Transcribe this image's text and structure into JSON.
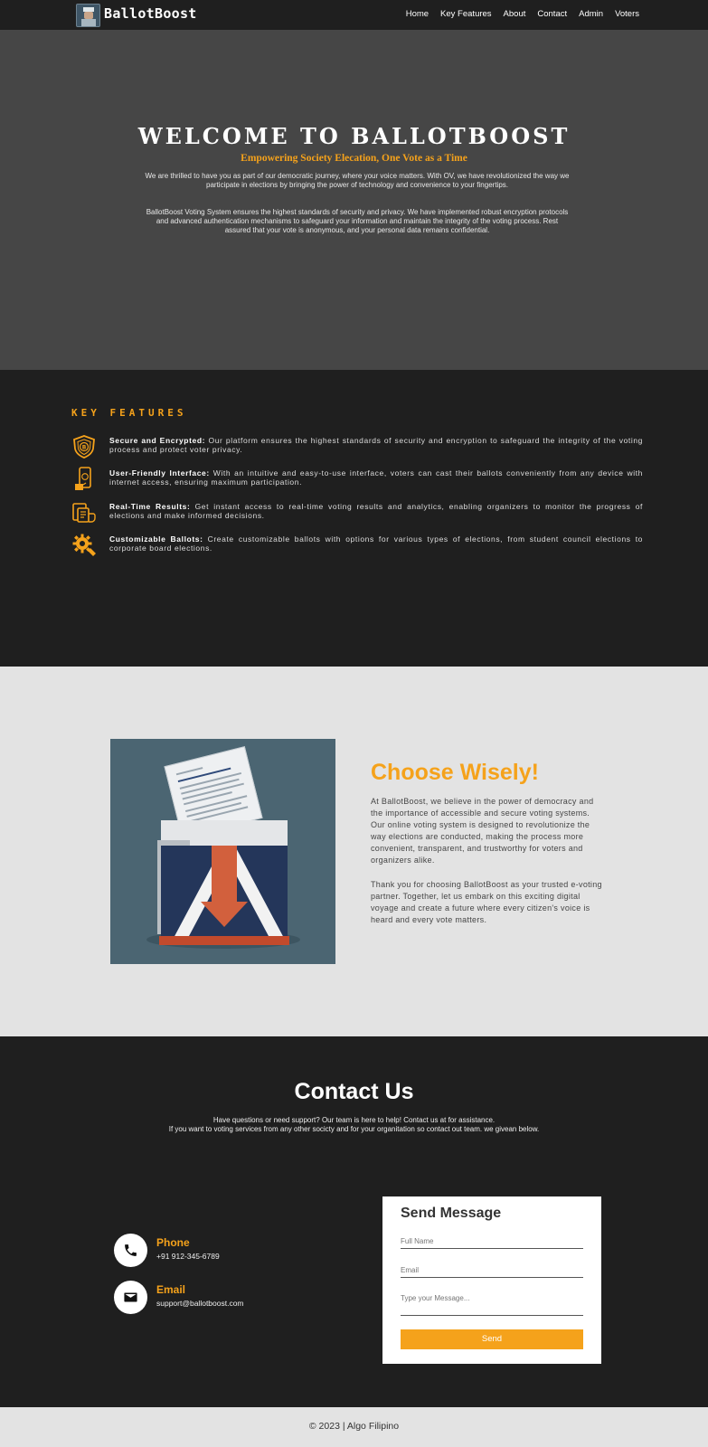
{
  "nav": {
    "brand": "BallotBoost",
    "links": [
      "Home",
      "Key Features",
      "About",
      "Contact",
      "Admin",
      "Voters"
    ]
  },
  "hero": {
    "title": "WELCOME TO BALLOTBOOST",
    "subtitle": "Empowering Society Elecation, One Vote as a Time",
    "para1": "We are thrilled to have you as part of our democratic journey, where your voice matters. With OV, we have revolutionized the way we participate in elections by bringing the power of technology and convenience to your fingertips.",
    "para2": "BallotBoost Voting System ensures the highest standards of security and privacy. We have implemented robust encryption protocols and advanced authentication mechanisms to safeguard your information and maintain the integrity of the voting process. Rest assured that your vote is anonymous, and your personal data remains confidential."
  },
  "features": {
    "heading": "KEY FEATURES",
    "items": [
      {
        "title": "Secure and Encrypted:",
        "text": "Our platform ensures the highest standards of security and encryption to safeguard the integrity of the voting process and protect voter privacy.",
        "icon": "shield-icon"
      },
      {
        "title": "User-Friendly Interface:",
        "text": "With an intuitive and easy-to-use interface, voters can cast their ballots conveniently from any device with internet access, ensuring maximum participation.",
        "icon": "phone-icon"
      },
      {
        "title": "Real-Time Results:",
        "text": "Get instant access to real-time voting results and analytics, enabling organizers to monitor the progress of elections and make informed decisions.",
        "icon": "report-icon"
      },
      {
        "title": "Customizable Ballots:",
        "text": "Create customizable ballots with options for various types of elections, from student council elections to corporate board elections.",
        "icon": "gear-icon"
      }
    ]
  },
  "about": {
    "heading": "Choose Wisely!",
    "para1": "At BallotBoost, we believe in the power of democracy and the importance of accessible and secure voting systems. Our online voting system is designed to revolutionize the way elections are conducted, making the process more convenient, transparent, and trustworthy for voters and organizers alike.",
    "para2": "Thank you for choosing BallotBoost as your trusted e-voting partner. Together, let us embark on this exciting digital voyage and create a future where every citizen's voice is heard and every vote matters."
  },
  "contact": {
    "heading": "Contact Us",
    "intro1": "Have questions or need support? Our team is here to help! Contact us at for assistance.",
    "intro2": "If you want to voting services from any other socicty and for your organitation so contact out team. we givean below.",
    "phone_label": "Phone",
    "phone_value": "+91 912-345-6789",
    "email_label": "Email",
    "email_value": "support@ballotboost.com",
    "form": {
      "heading": "Send Message",
      "name_placeholder": "Full Name",
      "email_placeholder": "Email",
      "message_placeholder": "Type your Message...",
      "send_label": "Send"
    }
  },
  "footer": {
    "text": "© 2023 | Algo Filipino"
  },
  "colors": {
    "accent": "#f5a21b",
    "dark": "#1f1f1f",
    "hero": "#464646",
    "light": "#e3e3e3"
  }
}
